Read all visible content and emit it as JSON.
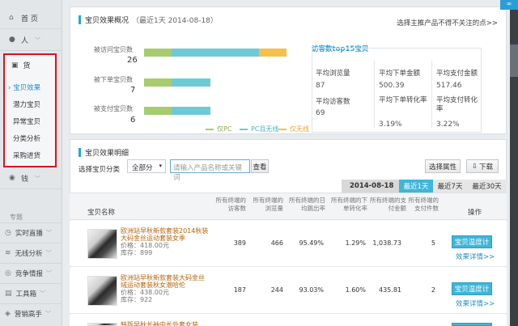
{
  "sidebar": {
    "home": "首 页",
    "people": "人",
    "goods": "货",
    "goods_sub": [
      "宝贝效果",
      "潜力宝贝",
      "异常宝贝",
      "分类分析",
      "采购进货"
    ],
    "money": "钱",
    "section": "专题",
    "bottom": [
      "实时直播",
      "无线分析",
      "竞争情报",
      "工具箱",
      "营销高手"
    ],
    "colors": {
      "highlight": "#e0101e",
      "active": "#1c8fc4"
    }
  },
  "overview": {
    "title": "宝贝效果概况",
    "date": "（最近1天 2014-08-18）",
    "top_link": "选择主推产品不得不关注的点>>",
    "metrics": [
      {
        "label": "被访问宝贝数",
        "value": "26",
        "pc": 0.18,
        "both": 0.57,
        "wireless": 0.18
      },
      {
        "label": "被下单宝贝数",
        "value": "7",
        "pc": 0.18,
        "both": 0.25,
        "wireless": 0
      },
      {
        "label": "被支付宝贝数",
        "value": "6",
        "pc": 0.18,
        "both": 0.25,
        "wireless": 0
      }
    ],
    "legend": [
      "仅PC",
      "PC且无线",
      "仅无线"
    ],
    "legend_colors": [
      "#a6cc6e",
      "#6ec9d6",
      "#f5c04a"
    ],
    "top15": {
      "title": "访客数top15宝贝",
      "cells": [
        {
          "label": "平均浏览量",
          "value": "87"
        },
        {
          "label": "平均下单金额",
          "value": "500.39"
        },
        {
          "label": "平均支付金额",
          "value": "517.46"
        },
        {
          "label": "平均访客数",
          "value": "69"
        },
        {
          "label": "平均下单转化率",
          "value": "3.19%"
        },
        {
          "label": "平均支付转化率",
          "value": "3.22%"
        }
      ]
    }
  },
  "detail": {
    "title": "宝贝效果明细",
    "filter_label": "选择宝贝分类",
    "select_value": "全部分",
    "search_placeholder": "请输入产品名称或关键词",
    "search_btn": "查看",
    "attr_btn": "选择属性",
    "download_btn": "下载",
    "date": "2014-08-18",
    "ranges": [
      "最近1天",
      "最近7天",
      "最近30天"
    ],
    "columns": {
      "name": "宝贝名称",
      "visitors": "所有终端的访客数",
      "pv": "所有终端的浏览量",
      "bounce": "所有终端的日均跳出率",
      "order_conv": "所有终端的下单转化率",
      "pay_amount": "所有终端的支付金额",
      "pay_qty": "所有终端的支付件数",
      "op": "操作"
    },
    "rows": [
      {
        "name": "欧洲站早秋新款套装2014秋装大码金丝运动套装女季",
        "price": "价格：418.00元",
        "stock": "库存：899",
        "visitors": "389",
        "pv": "466",
        "bounce": "95.49%",
        "order_conv": "1.29%",
        "pay_amount": "1,038.73",
        "pay_qty": "5",
        "btn": "宝贝温度计",
        "link": "效果详情>>"
      },
      {
        "name": "欧洲站早秋新款套装大码金丝绒运动套装秋女潮哈伦",
        "price": "价格：438.00元",
        "stock": "库存：922",
        "visitors": "187",
        "pv": "244",
        "bounce": "93.03%",
        "order_conv": "1.60%",
        "pay_amount": "435.81",
        "pay_qty": "2",
        "btn": "宝贝温度计",
        "link": "效果详情>>"
      },
      {
        "name": "韩版早秋长袖中长外套女装",
        "price": "",
        "stock": "",
        "visitors": "",
        "pv": "",
        "bounce": "",
        "order_conv": "",
        "pay_amount": "",
        "pay_qty": "",
        "btn": "",
        "link": ""
      }
    ]
  }
}
